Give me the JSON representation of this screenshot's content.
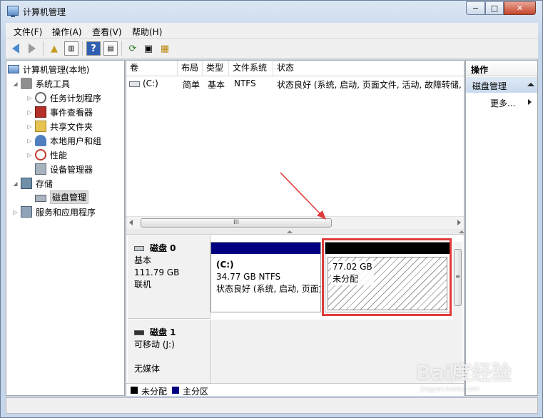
{
  "window": {
    "title": "计算机管理",
    "min": "−",
    "max": "□",
    "close": "✕"
  },
  "menu": [
    "文件(F)",
    "操作(A)",
    "查看(V)",
    "帮助(H)"
  ],
  "tree": {
    "root": "计算机管理(本地)",
    "system_tools": "系统工具",
    "task_scheduler": "任务计划程序",
    "event_viewer": "事件查看器",
    "shared_folders": "共享文件夹",
    "local_users": "本地用户和组",
    "performance": "性能",
    "device_manager": "设备管理器",
    "storage": "存储",
    "disk_management": "磁盘管理",
    "services_apps": "服务和应用程序"
  },
  "columns": [
    "卷",
    "布局",
    "类型",
    "文件系统",
    "状态"
  ],
  "volumes": [
    {
      "name": "(C:)",
      "layout": "简单",
      "type": "基本",
      "fs": "NTFS",
      "status": "状态良好 (系统, 启动, 页面文件, 活动, 故障转储, 主"
    }
  ],
  "hscroll_thumb": "III",
  "disks": [
    {
      "name": "磁盘 0",
      "type": "基本",
      "size": "111.79 GB",
      "state": "联机"
    },
    {
      "name": "磁盘 1",
      "type": "可移动 (J:)",
      "size": "",
      "state": "无媒体"
    }
  ],
  "partition_c": {
    "name": "(C:)",
    "size": "34.77 GB NTFS",
    "status": "状态良好 (系统, 启动, 页面文"
  },
  "partition_unalloc": {
    "size": "77.02 GB",
    "status": "未分配"
  },
  "legend": {
    "unallocated": "未分配",
    "primary": "主分区"
  },
  "actions": {
    "title": "操作",
    "section": "磁盘管理",
    "more": "更多..."
  },
  "watermark": {
    "brand": "Bai度经验",
    "url": "jingyan.baidu.com"
  },
  "colors": {
    "primary_partition": "#000080",
    "unallocated": "#000000",
    "highlight": "#e03c3c"
  }
}
